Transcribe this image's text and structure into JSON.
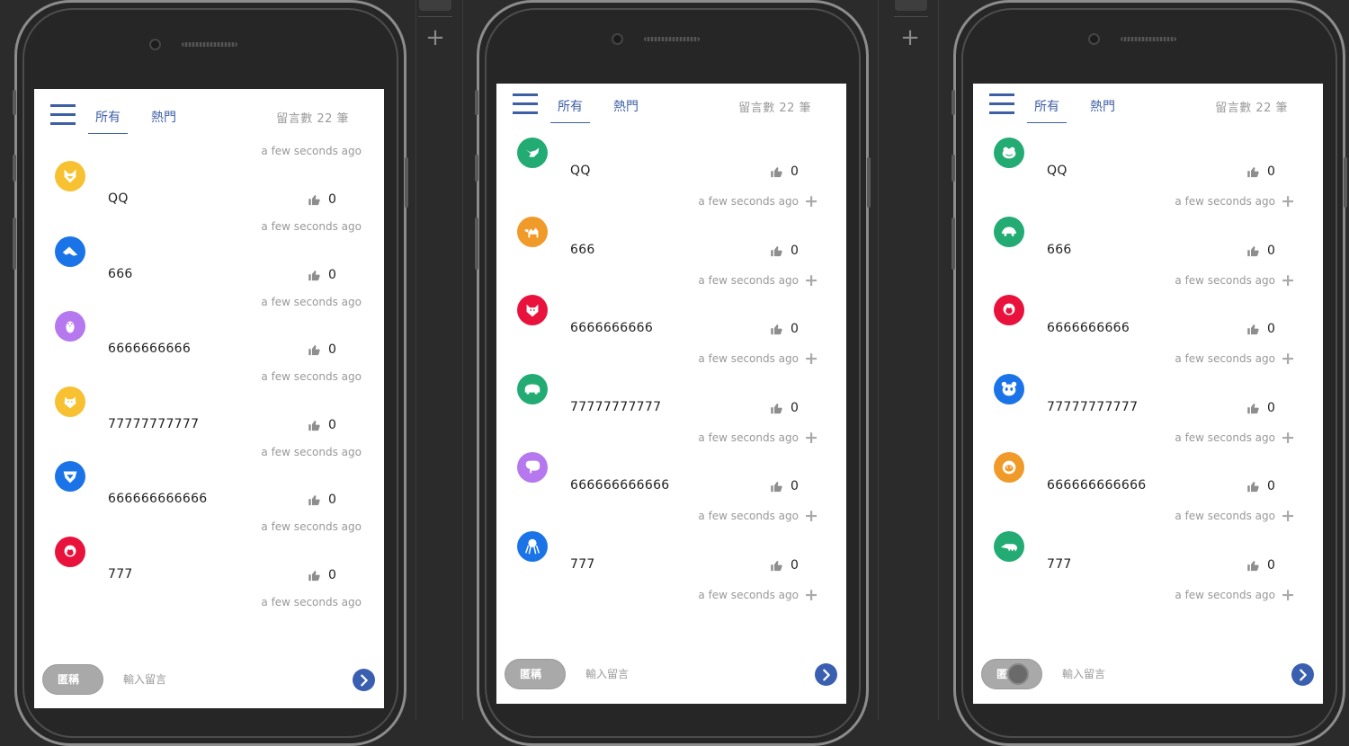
{
  "colors": {
    "accent": "#3d5fa6",
    "send": "#3a5fb0"
  },
  "screens": [
    {
      "tabs": [
        "所有",
        "熱門"
      ],
      "count_label": "留言數 22 筆",
      "header_time": "a few seconds ago",
      "show_add": false,
      "messages": [
        {
          "text": "QQ",
          "likes": "0",
          "time": "a few seconds ago",
          "avatar_color": "#f7c132",
          "animal": "fox-icon"
        },
        {
          "text": "666",
          "likes": "0",
          "time": "a few seconds ago",
          "avatar_color": "#1a74e8",
          "animal": "shark-icon"
        },
        {
          "text": "6666666666",
          "likes": "0",
          "time": "a few seconds ago",
          "avatar_color": "#b678ee",
          "animal": "penguin-icon"
        },
        {
          "text": "77777777777",
          "likes": "0",
          "time": "a few seconds ago",
          "avatar_color": "#f7c132",
          "animal": "squirrel-icon"
        },
        {
          "text": "666666666666",
          "likes": "0",
          "time": "a few seconds ago",
          "avatar_color": "#1a74e8",
          "animal": "lion-icon"
        },
        {
          "text": "777",
          "likes": "0",
          "time": "a few seconds ago",
          "avatar_color": "#e8123d",
          "animal": "monkey-icon"
        }
      ],
      "input": {
        "anon_label": "匿稱",
        "placeholder": "輸入留言"
      }
    },
    {
      "tabs": [
        "所有",
        "熱門"
      ],
      "count_label": "留言數 22 筆",
      "header_time": "",
      "show_add": true,
      "messages": [
        {
          "text": "QQ",
          "likes": "0",
          "time": "a few seconds ago",
          "avatar_color": "#22ab72",
          "animal": "bird-icon"
        },
        {
          "text": "666",
          "likes": "0",
          "time": "a few seconds ago",
          "avatar_color": "#f09a2a",
          "animal": "camel-icon"
        },
        {
          "text": "6666666666",
          "likes": "0",
          "time": "a few seconds ago",
          "avatar_color": "#e8123d",
          "animal": "cat-icon"
        },
        {
          "text": "77777777777",
          "likes": "0",
          "time": "a few seconds ago",
          "avatar_color": "#22ab72",
          "animal": "hippo-icon"
        },
        {
          "text": "666666666666",
          "likes": "0",
          "time": "a few seconds ago",
          "avatar_color": "#b678ee",
          "animal": "elephant-icon"
        },
        {
          "text": "777",
          "likes": "0",
          "time": "a few seconds ago",
          "avatar_color": "#1a74e8",
          "animal": "octopus-icon"
        }
      ],
      "input": {
        "anon_label": "匿稱",
        "placeholder": "輸入留言"
      }
    },
    {
      "tabs": [
        "所有",
        "熱門"
      ],
      "count_label": "留言數 22 筆",
      "header_time": "",
      "show_add": true,
      "messages": [
        {
          "text": "QQ",
          "likes": "0",
          "time": "a few seconds ago",
          "avatar_color": "#22ab72",
          "animal": "frog-icon"
        },
        {
          "text": "666",
          "likes": "0",
          "time": "a few seconds ago",
          "avatar_color": "#22ab72",
          "animal": "turtle-icon"
        },
        {
          "text": "6666666666",
          "likes": "0",
          "time": "a few seconds ago",
          "avatar_color": "#e8123d",
          "animal": "monkey-icon"
        },
        {
          "text": "77777777777",
          "likes": "0",
          "time": "a few seconds ago",
          "avatar_color": "#1a74e8",
          "animal": "panda-icon"
        },
        {
          "text": "666666666666",
          "likes": "0",
          "time": "a few seconds ago",
          "avatar_color": "#f09a2a",
          "animal": "sloth-icon"
        },
        {
          "text": "777",
          "likes": "0",
          "time": "a few seconds ago",
          "avatar_color": "#22ab72",
          "animal": "anteater-icon"
        }
      ],
      "input": {
        "anon_label": "匿稱",
        "placeholder": "輸入留言"
      }
    }
  ]
}
